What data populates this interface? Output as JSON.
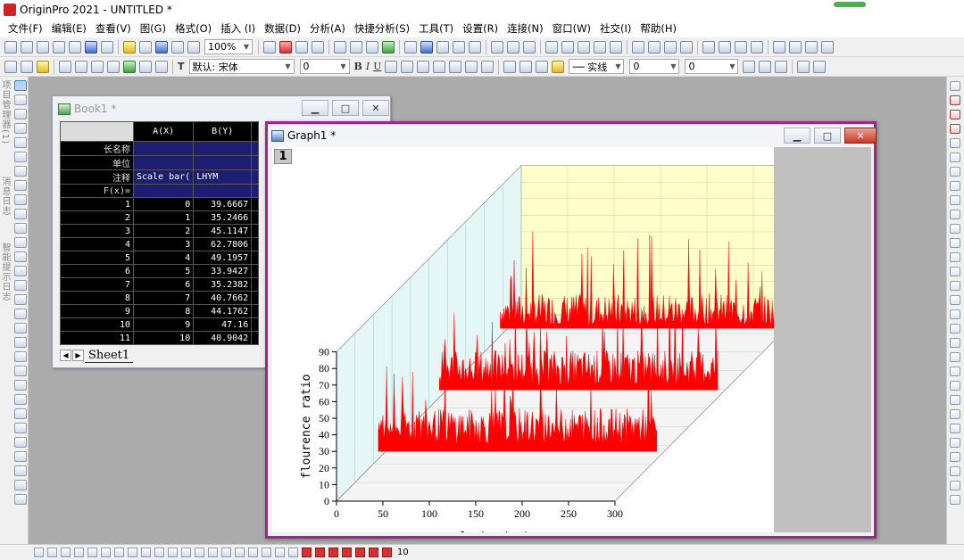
{
  "app": {
    "title": "OriginPro 2021 - UNTITLED *"
  },
  "menu": [
    "文件(F)",
    "编辑(E)",
    "查看(V)",
    "图(G)",
    "格式(O)",
    "插入 (I)",
    "数据(D)",
    "分析(A)",
    "快捷分析(S)",
    "工具(T)",
    "设置(R)",
    "连接(N)",
    "窗口(W)",
    "社交(I)",
    "帮助(H)"
  ],
  "toolbar": {
    "zoom": "100%",
    "font_prefix": "默认:",
    "font_name": "宋体",
    "font_size": "0",
    "line_style": "实线",
    "line_width": "0",
    "color_value": "0",
    "bottom_size": "10"
  },
  "sidebar": {
    "label1": "项目管理器(1)",
    "label2": "消息日志",
    "label3": "智能提示日志"
  },
  "book1": {
    "title": "Book1 *",
    "sheet_tab": "Sheet1",
    "columns": [
      "A(X)",
      "B(Y)"
    ],
    "meta_rows": [
      {
        "label": "长名称",
        "a": "",
        "b": ""
      },
      {
        "label": "单位",
        "a": "",
        "b": ""
      },
      {
        "label": "注释",
        "a": "Scale bar(",
        "b": "LHYM"
      },
      {
        "label": "F(x)=",
        "a": "",
        "b": ""
      }
    ],
    "rows": [
      {
        "n": "1",
        "a": "0",
        "b": "39.6667"
      },
      {
        "n": "2",
        "a": "1",
        "b": "35.2466"
      },
      {
        "n": "3",
        "a": "2",
        "b": "45.1147"
      },
      {
        "n": "4",
        "a": "3",
        "b": "62.7806"
      },
      {
        "n": "5",
        "a": "4",
        "b": "49.1957"
      },
      {
        "n": "6",
        "a": "5",
        "b": "33.9427"
      },
      {
        "n": "7",
        "a": "6",
        "b": "35.2382"
      },
      {
        "n": "8",
        "a": "7",
        "b": "40.7662"
      },
      {
        "n": "9",
        "a": "8",
        "b": "44.1762"
      },
      {
        "n": "10",
        "a": "9",
        "b": "47.16"
      },
      {
        "n": "11",
        "a": "10",
        "b": "40.9042"
      }
    ]
  },
  "graph1": {
    "title": "Graph1 *",
    "layer_label": "1"
  },
  "chart_data": {
    "type": "area",
    "subtype": "3D stacked wall / waterfall",
    "ylabel": "flourence ratio",
    "xlabel": "scale bar(μm)",
    "xlim": [
      0,
      300
    ],
    "ylim": [
      0,
      90
    ],
    "xticks": [
      0,
      50,
      100,
      150,
      200,
      250,
      300
    ],
    "yticks": [
      0,
      10,
      20,
      30,
      40,
      50,
      60,
      70,
      80,
      90
    ],
    "fill_color": "#ff0000",
    "back_wall_color": "#ffffcc",
    "side_wall_color": "#e4f6f6",
    "series": [
      {
        "depth": 0,
        "x_range": [
          45,
          345
        ],
        "approx_level": 45,
        "approx_peak": 88
      },
      {
        "depth": 1,
        "x_range": [
          45,
          345
        ],
        "approx_level": 43,
        "approx_peak": 82
      },
      {
        "depth": 2,
        "x_range": [
          45,
          345
        ],
        "approx_level": 40,
        "approx_peak": 86
      }
    ]
  }
}
